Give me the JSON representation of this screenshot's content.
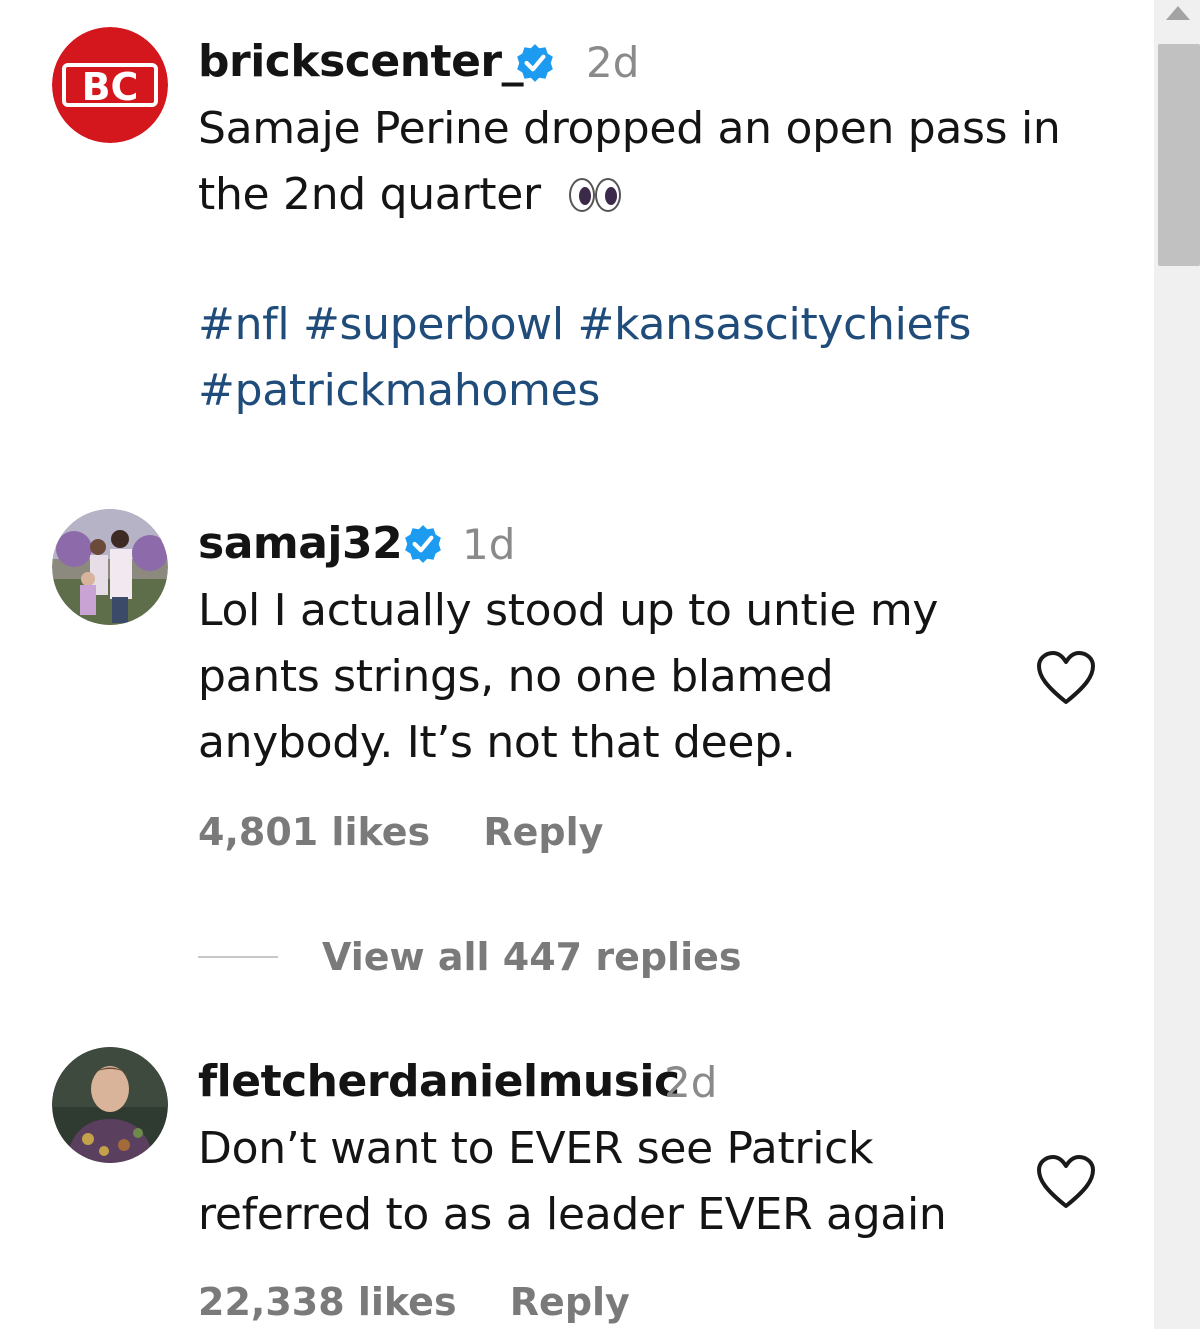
{
  "comments": [
    {
      "username": "brickscenter_",
      "avatar_text": "BC",
      "verified": true,
      "time": "2d",
      "text_lines": [
        "Samaje Perine dropped an open pass in",
        "the 2nd quarter"
      ],
      "emoji": "👀",
      "hashtag_lines": [
        [
          "#nfl",
          "#superbowl",
          "#kansascitychiefs"
        ],
        [
          "#patrickmahomes"
        ]
      ]
    },
    {
      "username": "samaj32",
      "verified": true,
      "time": "1d",
      "text_lines": [
        "Lol I actually stood up to untie my",
        "pants strings, no one blamed",
        "anybody. It’s not that deep."
      ],
      "likes": "4,801 likes",
      "reply_label": "Reply",
      "view_replies": "View all 447 replies"
    },
    {
      "username": "fletcherdanielmusic",
      "verified": false,
      "time": "2d",
      "text_lines": [
        "Don’t want to EVER see Patrick",
        "referred to as a leader EVER again"
      ],
      "likes": "22,338 likes",
      "reply_label": "Reply"
    }
  ],
  "colors": {
    "brand_red": "#d4161d",
    "verified_blue": "#1d9bf0",
    "hashtag": "#1f4c7a",
    "muted": "#7a7a7a"
  },
  "icons": [
    "verified-badge-icon",
    "heart-icon",
    "eyes-emoji",
    "scroll-up-arrow-icon"
  ]
}
